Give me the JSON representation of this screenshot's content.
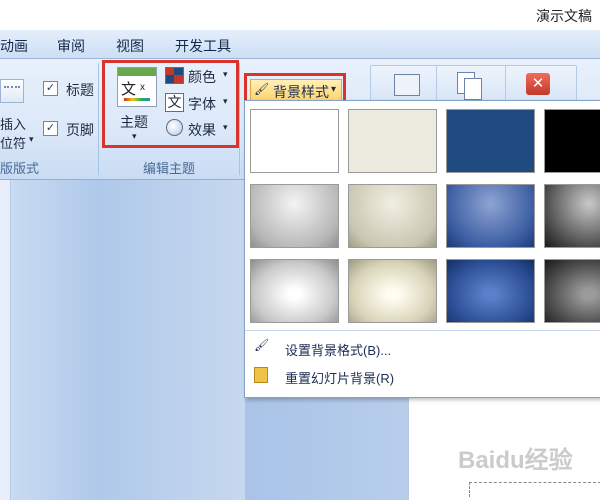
{
  "window": {
    "title": "演示文稿"
  },
  "menu": [
    "动画",
    "审阅",
    "视图",
    "开发工具"
  ],
  "ribbon": {
    "header_footer_group": {
      "insert_label_1": "插入",
      "insert_label_2": "位符",
      "title_check": "标题",
      "footer_check": "页脚",
      "group_label": "版版式",
      "check_mark": "✓"
    },
    "theme_group": {
      "themes_label": "主题",
      "colors_label": "颜色",
      "fonts_label": "字体",
      "effects_label": "效果",
      "group_label": "编辑主题",
      "theme_icon_text_1": "文",
      "theme_icon_text_2": "文"
    },
    "background_styles_button": {
      "label": "背景样式",
      "arrow": "▾"
    }
  },
  "dropdown": {
    "swatch_rows": 3,
    "commands": [
      {
        "label": "设置背景格式(B)..."
      },
      {
        "label": "重置幻灯片背景(R)"
      }
    ]
  },
  "colors": {
    "highlight_border": "#d9342b",
    "ribbon_bg": "#dbe8f8",
    "dark_blue_swatch": "#1f4b80"
  },
  "watermark": {
    "text": "Baidu经验"
  }
}
